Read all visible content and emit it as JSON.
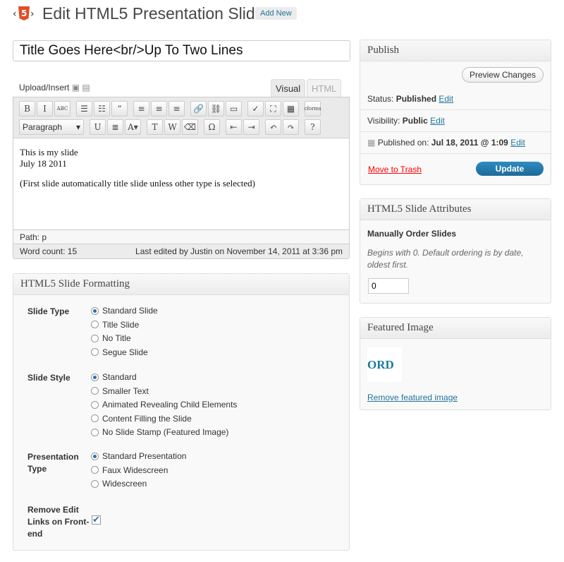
{
  "header": {
    "title": "Edit HTML5 Presentation Slide",
    "add_new": "Add New",
    "logo_text": "5"
  },
  "post_title": "Title Goes Here<br/>Up To Two Lines",
  "editor": {
    "upload_insert": "Upload/Insert",
    "tabs": [
      "Visual",
      "HTML"
    ],
    "format_select": "Paragraph",
    "content": [
      "This is my slide",
      "July 18 2011",
      "(First slide automatically title slide unless other type is selected)"
    ],
    "path": "Path: p",
    "word_count": "Word count: 15",
    "last_edited": "Last edited by Justin on November 14, 2011 at 3:36 pm",
    "toolbar_row1": [
      {
        "icon": "bold",
        "glyph": "B"
      },
      {
        "icon": "italic",
        "glyph": "I"
      },
      {
        "icon": "strikethrough",
        "glyph": "ABC"
      },
      {
        "icon": "bullet-list",
        "glyph": "☰"
      },
      {
        "icon": "numbered-list",
        "glyph": "☷"
      },
      {
        "icon": "blockquote",
        "glyph": "“"
      },
      {
        "icon": "align-left",
        "glyph": "≡"
      },
      {
        "icon": "align-center",
        "glyph": "≡"
      },
      {
        "icon": "align-right",
        "glyph": "≡"
      },
      {
        "icon": "link",
        "glyph": "🔗"
      },
      {
        "icon": "unlink",
        "glyph": "⛓"
      },
      {
        "icon": "more-tag",
        "glyph": "▭"
      },
      {
        "icon": "spellcheck",
        "glyph": "✓"
      },
      {
        "icon": "fullscreen",
        "glyph": "⛶"
      },
      {
        "icon": "kitchen-sink",
        "glyph": "▦"
      },
      {
        "icon": "cforms",
        "glyph": "cforms"
      }
    ],
    "toolbar_row2": [
      {
        "icon": "underline",
        "glyph": "U"
      },
      {
        "icon": "justify",
        "glyph": "≣"
      },
      {
        "icon": "text-color",
        "glyph": "A▾"
      },
      {
        "icon": "paste-text",
        "glyph": "T"
      },
      {
        "icon": "paste-word",
        "glyph": "W"
      },
      {
        "icon": "eraser",
        "glyph": "⌫"
      },
      {
        "icon": "special-char",
        "glyph": "Ω"
      },
      {
        "icon": "outdent",
        "glyph": "⇤"
      },
      {
        "icon": "indent",
        "glyph": "⇥"
      },
      {
        "icon": "undo",
        "glyph": "↶"
      },
      {
        "icon": "redo",
        "glyph": "↷"
      },
      {
        "icon": "help",
        "glyph": "?"
      }
    ]
  },
  "formatting": {
    "title": "HTML5 Slide Formatting",
    "groups": [
      {
        "label": "Slide Type",
        "options": [
          "Standard Slide",
          "Title Slide",
          "No Title",
          "Segue Slide"
        ],
        "selected": 0
      },
      {
        "label": "Slide Style",
        "options": [
          "Standard",
          "Smaller Text",
          "Animated Revealing Child Elements",
          "Content Filling the Slide",
          "No Slide Stamp (Featured Image)"
        ],
        "selected": 0
      },
      {
        "label": "Presentation Type",
        "options": [
          "Standard Presentation",
          "Faux Widescreen",
          "Widescreen"
        ],
        "selected": 0
      }
    ],
    "remove_edit_label": "Remove Edit Links on Front-end",
    "remove_edit_checked": true
  },
  "publish": {
    "title": "Publish",
    "preview": "Preview Changes",
    "status_label": "Status: ",
    "status": "Published",
    "visibility_label": "Visibility: ",
    "visibility": "Public",
    "published_label": "Published on: ",
    "published": "Jul 18, 2011 @ 1:09",
    "edit": "Edit",
    "trash": "Move to Trash",
    "update": "Update",
    "colors": {
      "trash": "#ff0000",
      "update": "#21759b"
    }
  },
  "attributes": {
    "title": "HTML5 Slide Attributes",
    "label": "Manually Order Slides",
    "help": "Begins with 0. Default ordering is by date, oldest first.",
    "value": "0"
  },
  "featured": {
    "title": "Featured Image",
    "image_text": "ORD",
    "remove": "Remove featured image"
  }
}
